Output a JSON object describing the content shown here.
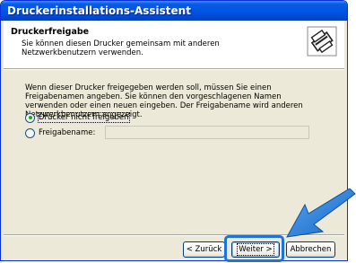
{
  "window": {
    "title": "Druckerinstallations-Assistent"
  },
  "header": {
    "title": "Druckerfreigabe",
    "subtitle": "Sie können diesen Drucker gemeinsam mit anderen Netzwerkbenutzern verwenden.",
    "icon": "printer-share-icon"
  },
  "body": {
    "description": "Wenn dieser Drucker freigegeben werden soll, müssen Sie einen Freigabenamen angeben. Sie können den vorgeschlagenen Namen verwenden oder einen neuen eingeben. Der Freigabename wird anderen Netzwerkbenutzern angezeigt.",
    "option_no_share": "Drucker nicht freigeben",
    "option_share_name": "Freigabename:",
    "share_name_value": ""
  },
  "buttons": {
    "back": "< Zurück",
    "next": "Weiter >",
    "cancel": "Abbrechen"
  },
  "colors": {
    "titlebar": "#0054e3",
    "highlight": "#1e73d8",
    "dialog_bg": "#ece9d8"
  }
}
